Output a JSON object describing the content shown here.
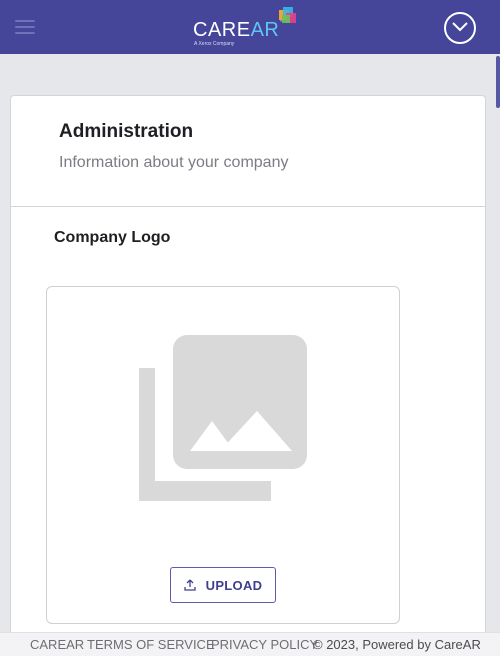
{
  "header": {
    "brand": {
      "word_care": "CARE",
      "word_ar": "AR",
      "trademark": "™",
      "tagline": "A Xerox Company"
    },
    "menu_icon": "hamburger-menu-icon",
    "user_icon": "chevron-down-circle-icon"
  },
  "page": {
    "title": "Administration",
    "subtitle": "Information about your company"
  },
  "company_logo": {
    "label": "Company Logo",
    "placeholder_icon": "image-gallery-placeholder-icon",
    "upload_label": "UPLOAD",
    "upload_icon": "upload-icon"
  },
  "footer": {
    "links": [
      "CAREAR",
      "TERMS OF SERVICE",
      "PRIVACY POLICY"
    ],
    "copyright": "© 2023, Powered by CareAR"
  },
  "colors": {
    "header_bg": "#45459a",
    "accent": "#3f3f8e",
    "page_bg": "#e6e7ea",
    "placeholder_gray": "#d9d9d9"
  }
}
